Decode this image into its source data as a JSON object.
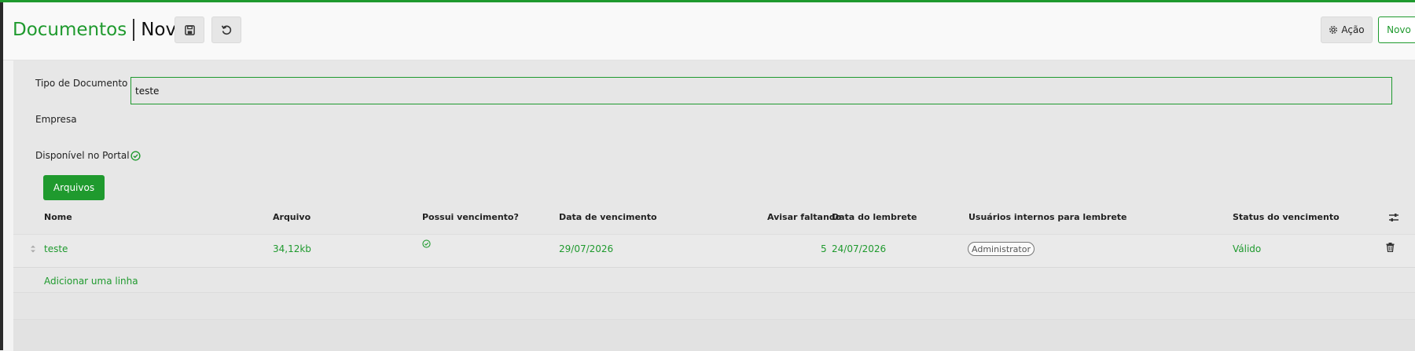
{
  "breadcrumb": {
    "parent": "Documentos",
    "current": "Novo"
  },
  "toolbar": {
    "acao_label": "Ação",
    "novo_label": "Novo"
  },
  "form": {
    "tipo_label": "Tipo de Documento",
    "tipo_value": "teste",
    "empresa_label": "Empresa",
    "portal_label": "Disponível no Portal",
    "portal_checked": true
  },
  "tabs": {
    "arquivos": "Arquivos"
  },
  "table": {
    "headers": {
      "nome": "Nome",
      "arquivo": "Arquivo",
      "possui": "Possui vencimento?",
      "data_venc": "Data de vencimento",
      "avisar": "Avisar faltando",
      "data_lembrete": "Data do lembrete",
      "usuarios": "Usuários internos para lembrete",
      "status": "Status do vencimento"
    },
    "rows": [
      {
        "nome": "teste",
        "arquivo": "34,12kb",
        "possui": true,
        "data_venc": "29/07/2026",
        "avisar": "5",
        "data_lembrete": "24/07/2026",
        "usuario": "Administrator",
        "status": "Válido"
      }
    ],
    "add_line": "Adicionar uma linha"
  },
  "colors": {
    "accent": "#1f9a2e"
  }
}
